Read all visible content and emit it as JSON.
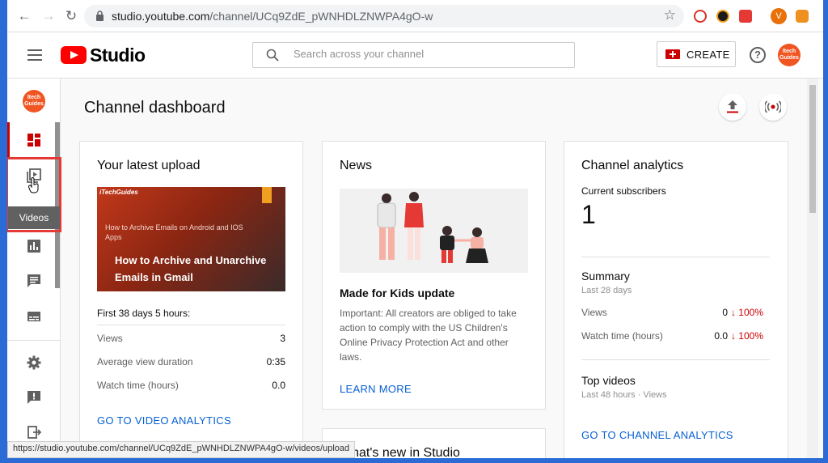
{
  "browser": {
    "url_host": "studio.youtube.com",
    "url_path": "/channel/UCq9ZdE_pWNHDLZNWPA4gO-w",
    "profile_initial": "V",
    "status_url": "https://studio.youtube.com/channel/UCq9ZdE_pWNHDLZNWPA4gO-w/videos/upload"
  },
  "header": {
    "logo_text": "Studio",
    "search_placeholder": "Search across your channel",
    "create_label": "CREATE",
    "help_glyph": "?",
    "avatar_text": "Itech Guides"
  },
  "sidebar": {
    "channel_avatar_text": "Itech Guides",
    "tooltip": "Videos",
    "items": [
      "dashboard-icon",
      "videos-icon",
      "analytics-icon",
      "comments-icon",
      "subtitles-icon",
      "settings-icon",
      "feedback-icon",
      "creator-studio-classic-icon"
    ]
  },
  "main": {
    "title": "Channel dashboard",
    "latest_upload": {
      "title": "Your latest upload",
      "thumb_brand": "iTechGuides",
      "thumb_small": "How to Archive Emails on Android and IOS Apps",
      "thumb_big": "How to Archive and Unarchive Emails in Gmail",
      "period": "First 38 days 5 hours:",
      "rows": [
        {
          "label": "Views",
          "value": "3"
        },
        {
          "label": "Average view duration",
          "value": "0:35"
        },
        {
          "label": "Watch time (hours)",
          "value": "0.0"
        }
      ],
      "link": "GO TO VIDEO ANALYTICS"
    },
    "news": {
      "title": "News",
      "headline": "Made for Kids update",
      "body": "Important: All creators are obliged to take action to comply with the US Children's Online Privacy Protection Act and other laws.",
      "link": "LEARN MORE"
    },
    "whats_new": {
      "title": "What's new in Studio"
    },
    "analytics": {
      "title": "Channel analytics",
      "subs_label": "Current subscribers",
      "subs_value": "1",
      "summary_title": "Summary",
      "summary_period": "Last 28 days",
      "rows": [
        {
          "label": "Views",
          "value": "0",
          "change": "↓ 100%"
        },
        {
          "label": "Watch time (hours)",
          "value": "0.0",
          "change": "↓ 100%"
        }
      ],
      "top_title": "Top videos",
      "top_period": "Last 48 hours · Views",
      "link": "GO TO CHANNEL ANALYTICS"
    }
  },
  "colors": {
    "brand_red": "#ff0000",
    "link_blue": "#065fd4",
    "decline_red": "#cc0000",
    "avatar_orange": "#f05522"
  }
}
